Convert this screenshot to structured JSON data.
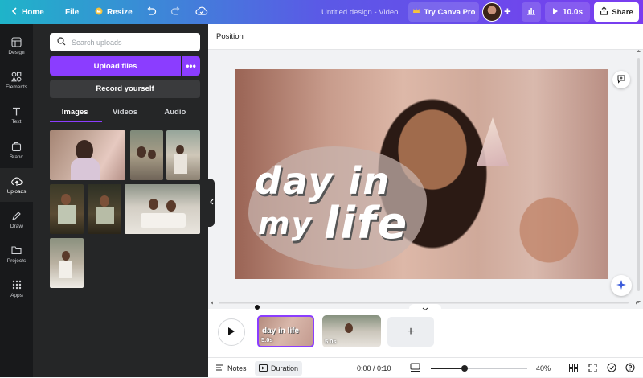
{
  "topbar": {
    "home_label": "Home",
    "file_label": "File",
    "resize_label": "Resize",
    "doc_title": "Untitled design - Video",
    "pro_label": "Try Canva Pro",
    "play_duration": "10.0s",
    "share_label": "Share"
  },
  "rail": {
    "items": [
      {
        "label": "Design",
        "icon": "layout-icon"
      },
      {
        "label": "Elements",
        "icon": "shapes-icon"
      },
      {
        "label": "Text",
        "icon": "text-icon"
      },
      {
        "label": "Brand",
        "icon": "brand-icon"
      },
      {
        "label": "Uploads",
        "icon": "cloud-upload-icon"
      },
      {
        "label": "Draw",
        "icon": "pen-icon"
      },
      {
        "label": "Projects",
        "icon": "folder-icon"
      },
      {
        "label": "Apps",
        "icon": "apps-grid-icon"
      }
    ],
    "active": "Uploads"
  },
  "panel": {
    "search_placeholder": "Search uploads",
    "upload_label": "Upload files",
    "more_label": "•••",
    "record_label": "Record yourself",
    "tabs": [
      "Images",
      "Videos",
      "Audio"
    ],
    "active_tab": "Images"
  },
  "editor": {
    "property_label": "Position",
    "canvas_text_line1": "day in",
    "canvas_text_line2a": "my",
    "canvas_text_line2b": "life"
  },
  "timeline": {
    "clips": [
      {
        "duration": "5.0s",
        "text": "day in life"
      },
      {
        "duration": "5.0s"
      }
    ],
    "add_label": "+"
  },
  "bottombar": {
    "notes_label": "Notes",
    "duration_label": "Duration",
    "time": "0:00 / 0:10",
    "zoom": "40%",
    "zoom_fraction": 0.35
  },
  "colors": {
    "accent": "#8b3dff",
    "rail_bg": "#18191b",
    "panel_bg": "#252627"
  }
}
